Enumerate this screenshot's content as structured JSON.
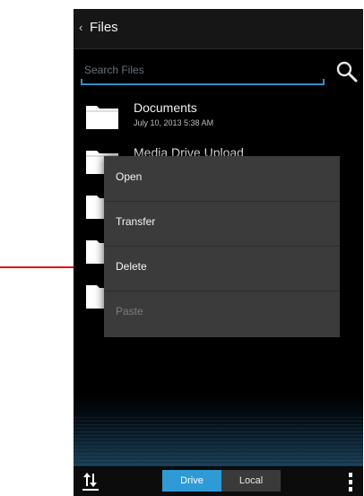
{
  "topbar": {
    "back_glyph": "‹",
    "title": "Files"
  },
  "search": {
    "placeholder": "Search Files",
    "value": "",
    "icon": "search-icon"
  },
  "files": [
    {
      "name": "Documents",
      "date": "July 10, 2013 5:38 AM"
    },
    {
      "name": "Media Drive Upload",
      "date": ""
    },
    {
      "name": "",
      "date": ""
    },
    {
      "name": "",
      "date": ""
    },
    {
      "name": "",
      "date": ""
    }
  ],
  "context_menu": {
    "items": [
      {
        "label": "Open",
        "enabled": true
      },
      {
        "label": "Transfer",
        "enabled": true
      },
      {
        "label": "Delete",
        "enabled": true
      },
      {
        "label": "Paste",
        "enabled": false
      }
    ]
  },
  "bottombar": {
    "transfer_icon": "transfer-arrows-icon",
    "tabs": [
      {
        "label": "Drive",
        "active": true
      },
      {
        "label": "Local",
        "active": false
      }
    ],
    "overflow_icon": "overflow-menu-icon"
  },
  "colors": {
    "accent": "#2e9bd6",
    "search_underline": "#2f8fc9",
    "menu_bg": "#3b3b3b",
    "annotation_arrow": "#e01010"
  }
}
